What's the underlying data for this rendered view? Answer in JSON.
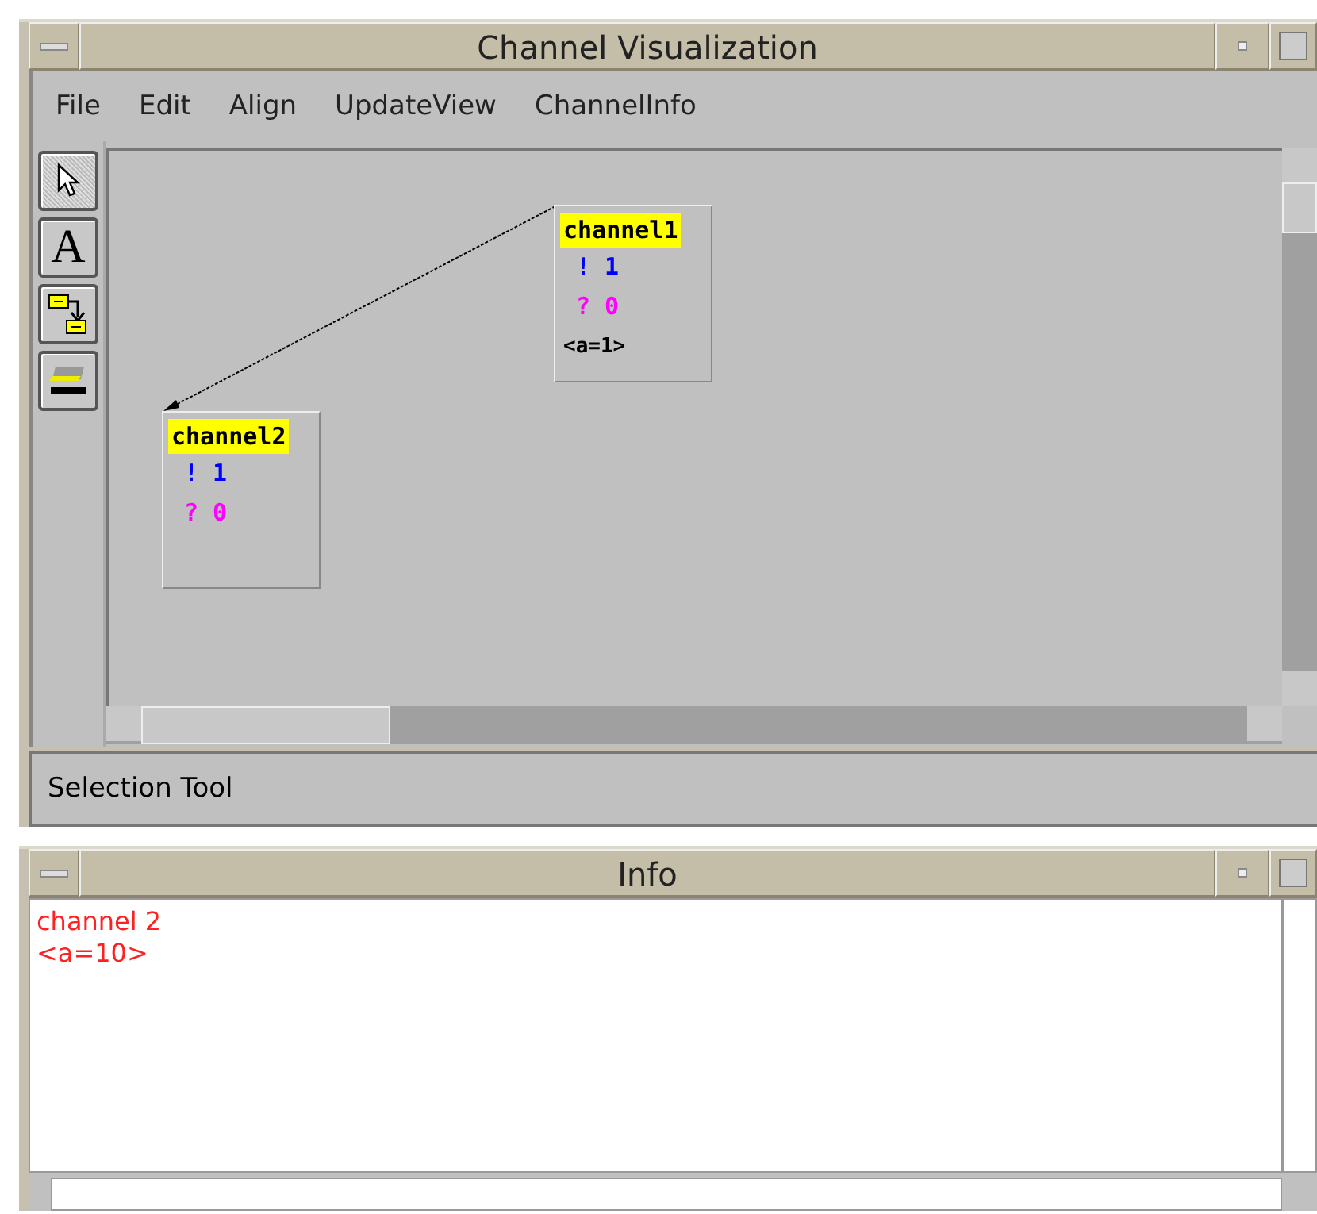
{
  "main_window": {
    "title": "Channel Visualization",
    "menu": [
      "File",
      "Edit",
      "Align",
      "UpdateView",
      "ChannelInfo"
    ],
    "tools": [
      {
        "kind": "pointer",
        "selected": true
      },
      {
        "kind": "text",
        "label": "A",
        "selected": false
      },
      {
        "kind": "connector",
        "selected": false
      },
      {
        "kind": "distributor",
        "selected": false
      }
    ],
    "channels": [
      {
        "name": "channel1",
        "lines": [
          {
            "kind": "send",
            "text": "! 1"
          },
          {
            "kind": "receive",
            "text": "? 0"
          },
          {
            "kind": "value",
            "text": "<a=1>"
          }
        ]
      },
      {
        "name": "channel2",
        "lines": [
          {
            "kind": "send",
            "text": "! 1"
          },
          {
            "kind": "receive",
            "text": "? 0"
          }
        ]
      }
    ],
    "status": "Selection Tool"
  },
  "info_window": {
    "title": "Info",
    "lines": [
      "channel 2",
      "<a=10>"
    ]
  }
}
